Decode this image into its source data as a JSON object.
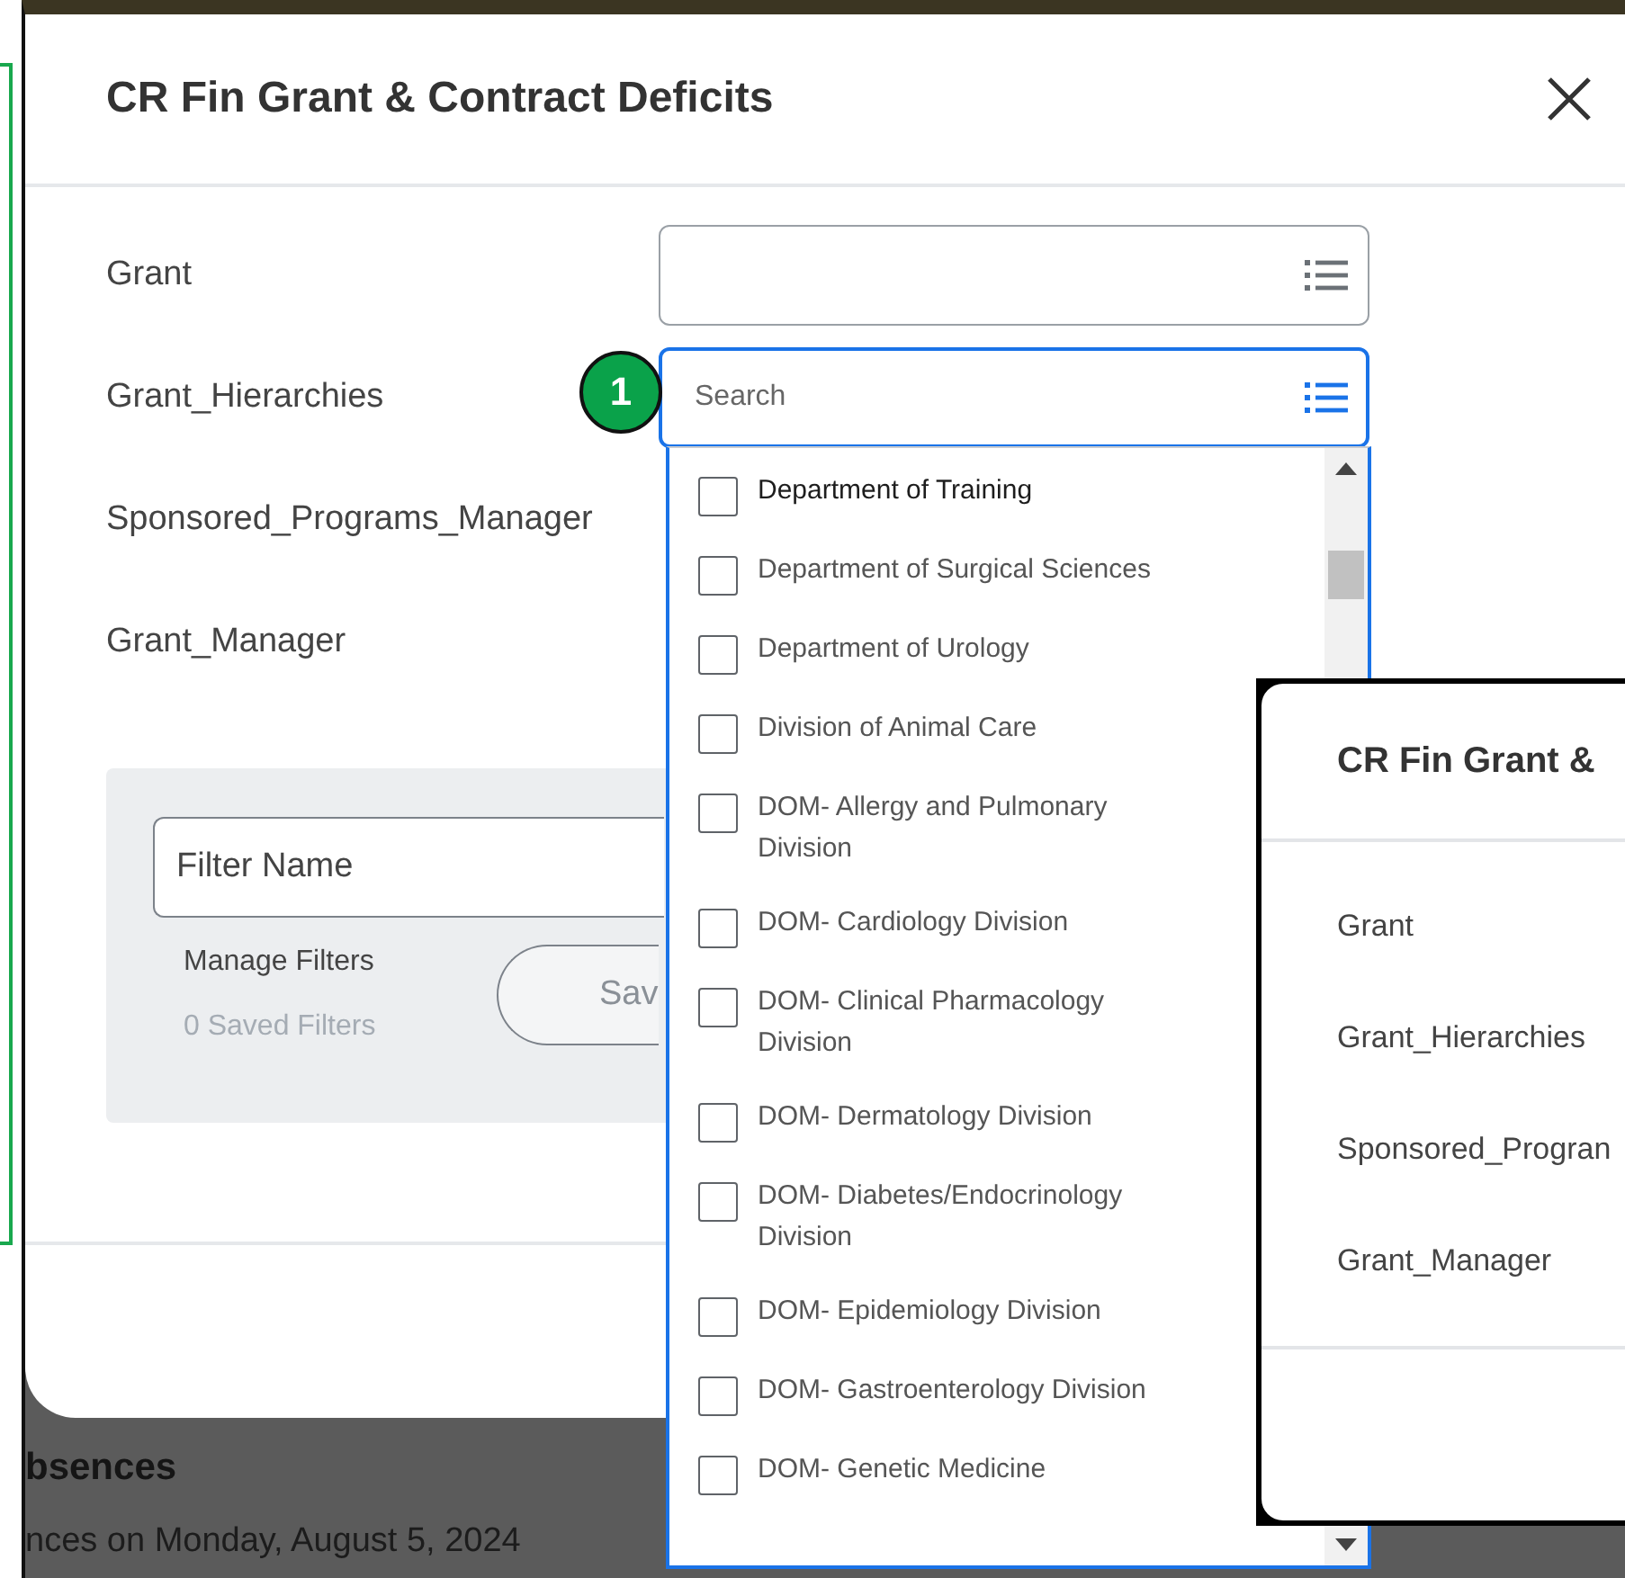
{
  "dialog": {
    "title": "CR Fin Grant & Contract Deficits",
    "fields": [
      {
        "label": "Grant",
        "kind": "lookup"
      },
      {
        "label": "Grant_Hierarchies",
        "kind": "search",
        "placeholder": "Search"
      },
      {
        "label": "Sponsored_Programs_Manager",
        "kind": "covered"
      },
      {
        "label": "Grant_Manager",
        "kind": "covered"
      }
    ],
    "filter": {
      "placeholder": "Filter Name",
      "manage_label": "Manage Filters",
      "saved_count": "0 Saved Filters",
      "save_button": "Sav"
    }
  },
  "dropdown": {
    "items": [
      {
        "label": "Department of Training",
        "checked": false,
        "highlighted": true
      },
      {
        "label": "Department of Surgical Sciences",
        "checked": false,
        "highlighted": false
      },
      {
        "label": "Department of Urology",
        "checked": false,
        "highlighted": false
      },
      {
        "label": "Division of Animal Care",
        "checked": false,
        "highlighted": false
      },
      {
        "label": "DOM- Allergy and Pulmonary Division",
        "checked": false,
        "highlighted": false
      },
      {
        "label": "DOM- Cardiology Division",
        "checked": false,
        "highlighted": false
      },
      {
        "label": "DOM- Clinical Pharmacology Division",
        "checked": false,
        "highlighted": false
      },
      {
        "label": "DOM- Dermatology Division",
        "checked": false,
        "highlighted": false
      },
      {
        "label": "DOM- Diabetes/Endocrinology Division",
        "checked": false,
        "highlighted": false
      },
      {
        "label": "DOM- Epidemiology Division",
        "checked": false,
        "highlighted": false
      },
      {
        "label": "DOM- Gastroenterology Division",
        "checked": false,
        "highlighted": false
      },
      {
        "label": "DOM- Genetic Medicine",
        "checked": false,
        "highlighted": false
      }
    ]
  },
  "callout": {
    "number": "1"
  },
  "background": {
    "heading": "bsences",
    "subtitle": "nces on Monday, August 5, 2024"
  },
  "inset_dialog": {
    "title": "CR Fin Grant &",
    "labels": [
      "Grant",
      "Grant_Hierarchies",
      "Sponsored_Progran",
      "Grant_Manager"
    ]
  }
}
